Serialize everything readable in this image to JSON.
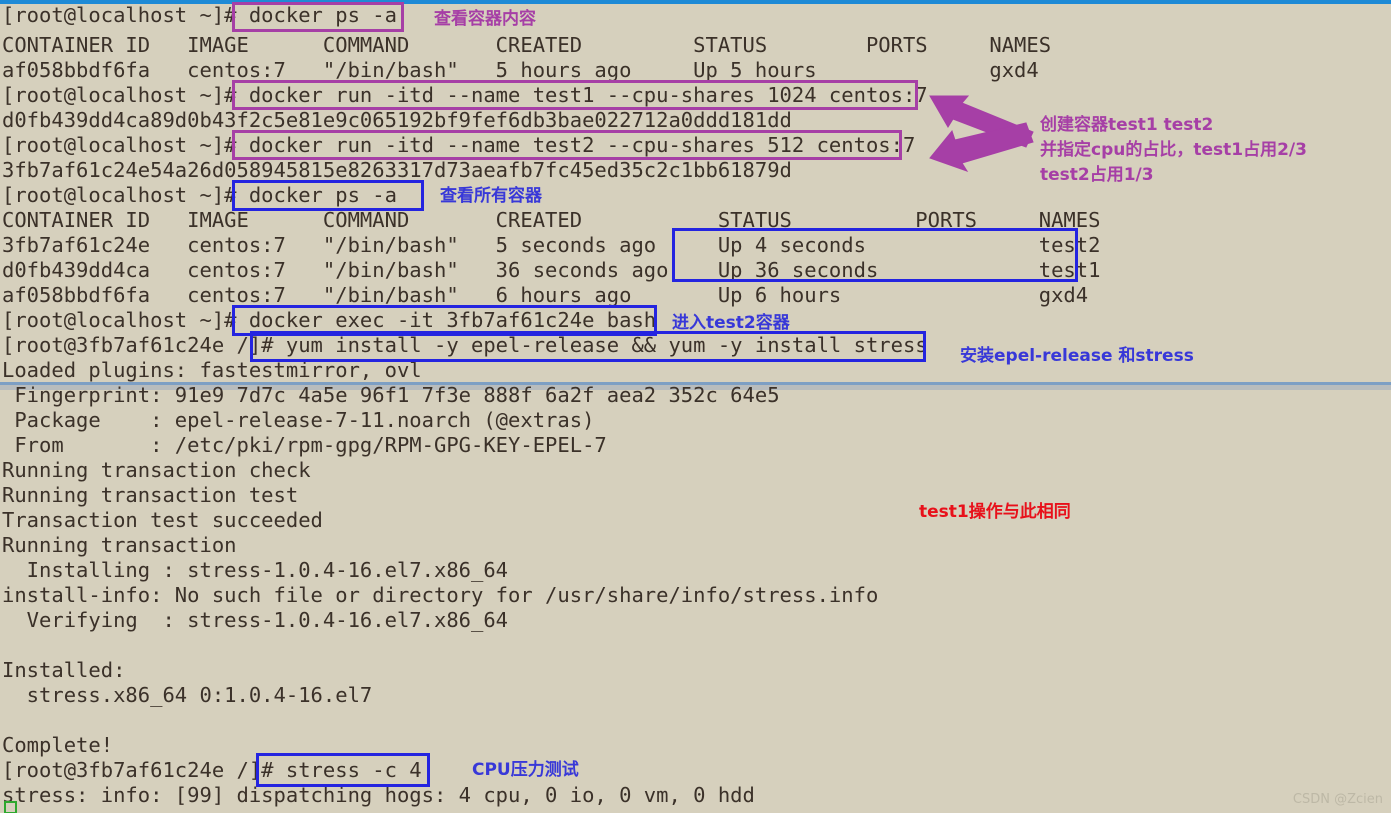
{
  "meta": {
    "watermark": "CSDN @Zcien",
    "accent_purple": "#a63fa6",
    "accent_blue": "#2424e0",
    "accent_red": "#e8101a",
    "terminal_bg": "#d6d0bd",
    "terminal_fg": "#3b3129",
    "titlebar_color": "#1e8ad6",
    "cursor_color": "#2fa82f"
  },
  "terminal": {
    "lines": [
      "[root@localhost ~]# docker ps -a",
      "CONTAINER ID   IMAGE      COMMAND       CREATED         STATUS        PORTS     NAMES",
      "af058bbdf6fa   centos:7   \"/bin/bash\"   5 hours ago     Up 5 hours              gxd4",
      "[root@localhost ~]# docker run -itd --name test1 --cpu-shares 1024 centos:7",
      "d0fb439dd4ca89d0b43f2c5e81e9c065192bf9fef6db3bae022712a0ddd181dd",
      "[root@localhost ~]# docker run -itd --name test2 --cpu-shares 512 centos:7",
      "3fb7af61c24e54a26d058945815e8263317d73aeafb7fc45ed35c2c1bb61879d",
      "[root@localhost ~]# docker ps -a",
      "CONTAINER ID   IMAGE      COMMAND       CREATED           STATUS          PORTS     NAMES",
      "3fb7af61c24e   centos:7   \"/bin/bash\"   5 seconds ago     Up 4 seconds              test2",
      "d0fb439dd4ca   centos:7   \"/bin/bash\"   36 seconds ago    Up 36 seconds             test1",
      "af058bbdf6fa   centos:7   \"/bin/bash\"   6 hours ago       Up 6 hours                gxd4",
      "[root@localhost ~]# docker exec -it 3fb7af61c24e bash",
      "[root@3fb7af61c24e /]# yum install -y epel-release && yum -y install stress",
      "Loaded plugins: fastestmirror, ovl"
    ],
    "lines_lower": [
      " Fingerprint: 91e9 7d7c 4a5e 96f1 7f3e 888f 6a2f aea2 352c 64e5",
      " Package    : epel-release-7-11.noarch (@extras)",
      " From       : /etc/pki/rpm-gpg/RPM-GPG-KEY-EPEL-7",
      "Running transaction check",
      "Running transaction test",
      "Transaction test succeeded",
      "Running transaction",
      "  Installing : stress-1.0.4-16.el7.x86_64",
      "install-info: No such file or directory for /usr/share/info/stress.info",
      "  Verifying  : stress-1.0.4-16.el7.x86_64",
      "",
      "Installed:",
      "  stress.x86_64 0:1.0.4-16.el7",
      "",
      "Complete!",
      "[root@3fb7af61c24e /]# stress -c 4",
      "stress: info: [99] dispatching hogs: 4 cpu, 0 io, 0 vm, 0 hdd"
    ]
  },
  "annotations": {
    "view_container_content": "查看容器内容",
    "create_containers_line1": "创建容器test1 test2",
    "create_containers_line2": "并指定cpu的占比，test1占用2/3",
    "create_containers_line3": "test2占用1/3",
    "view_all_containers": "查看所有容器",
    "enter_test2_container": "进入test2容器",
    "install_epel_stress": "安装epel-release 和stress",
    "test1_same_operation": "test1操作与此相同",
    "cpu_stress_test": "CPU压力测试"
  },
  "highlighted_commands": {
    "docker_ps_a_1": "docker ps -a",
    "docker_run_test1": "docker run -itd --name test1 --cpu-shares 1024 centos:7",
    "docker_run_test2": "docker run -itd --name test2 --cpu-shares 512 centos:7",
    "docker_ps_a_2": "docker ps -a",
    "docker_exec_test2": "docker exec -it 3fb7af61c24e bash",
    "yum_install": "yum install -y epel-release && yum -y install stress",
    "stress_c4": "stress -c 4",
    "status_block": "Up 4 seconds / Up 36 seconds  test2 / test1"
  }
}
